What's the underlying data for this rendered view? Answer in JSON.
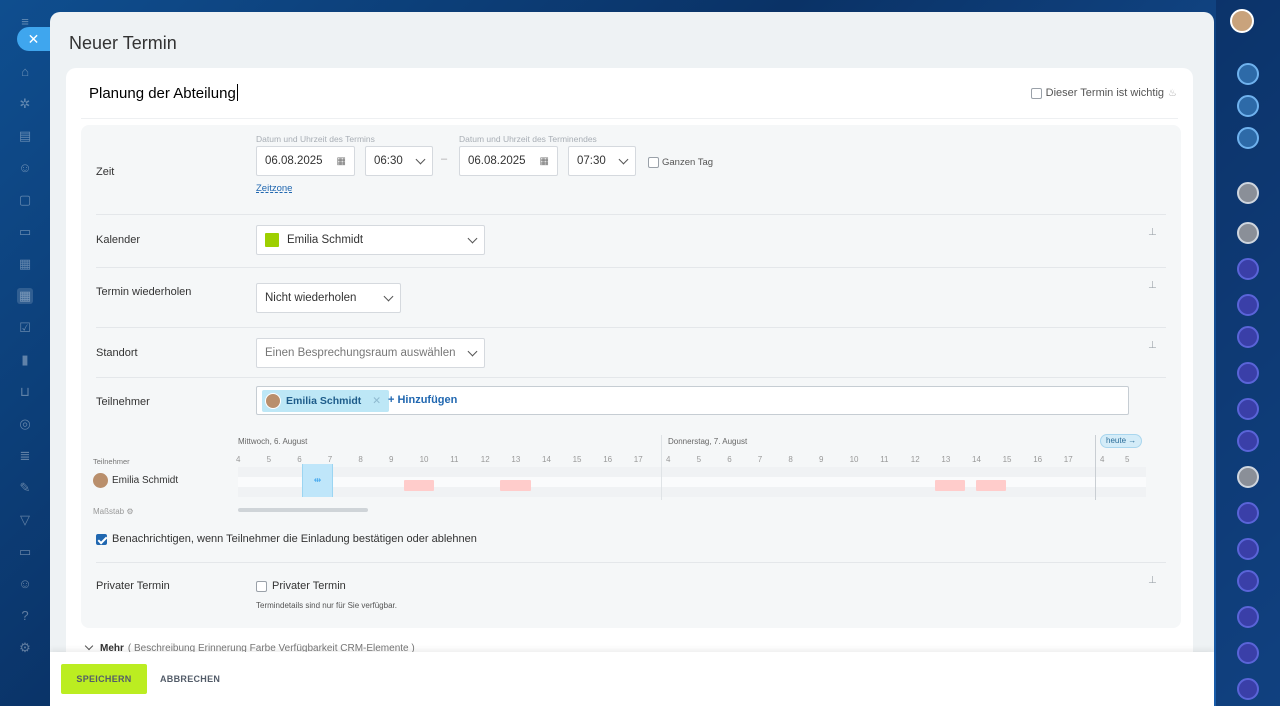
{
  "dialog": {
    "title": "Neuer Termin",
    "event_name": "Planung der Abteilung",
    "important_label": "Dieser Termin ist wichtig"
  },
  "time": {
    "label": "Zeit",
    "start_caption": "Datum und Uhrzeit des Termins",
    "end_caption": "Datum und Uhrzeit des Terminendes",
    "start_date": "06.08.2025",
    "start_time": "06:30",
    "end_date": "06.08.2025",
    "end_time": "07:30",
    "dash": "–",
    "all_day_label": "Ganzen Tag",
    "timezone_link": "Zeitzone"
  },
  "calendar": {
    "label": "Kalender",
    "value": "Emilia Schmidt",
    "color": "#9dcf00"
  },
  "repeat": {
    "label": "Termin wiederholen",
    "value": "Nicht wiederholen"
  },
  "location": {
    "label": "Standort",
    "placeholder": "Einen Besprechungsraum auswählen"
  },
  "attendees": {
    "label": "Teilnehmer",
    "tags": [
      "Emilia Schmidt"
    ],
    "add_label": "+ Hinzufügen"
  },
  "planner": {
    "attendees_title": "Teilnehmer",
    "days": [
      {
        "label": "Mittwoch, 6. August",
        "hours": [
          "4",
          "5",
          "6",
          "7",
          "8",
          "9",
          "10",
          "11",
          "12",
          "13",
          "14",
          "15",
          "16",
          "17"
        ]
      },
      {
        "label": "Donnerstag, 7. August",
        "hours": [
          "4",
          "5",
          "6",
          "7",
          "8",
          "9",
          "10",
          "11",
          "12",
          "13",
          "14",
          "15",
          "16",
          "17"
        ]
      }
    ],
    "next_day_hours": [
      "4",
      "5"
    ],
    "today_label": "heute →",
    "attendee": "Emilia Schmidt",
    "scale_label": "Maßstab"
  },
  "notify": {
    "label": "Benachrichtigen, wenn Teilnehmer die Einladung bestätigen oder ablehnen",
    "checked": true
  },
  "private": {
    "label": "Privater Termin",
    "checkbox_label": "Privater Termin",
    "hint": "Termindetails sind nur für Sie verfügbar."
  },
  "more": {
    "label": "Mehr",
    "items": "( Beschreibung   Erinnerung   Farbe   Verfügbarkeit   CRM-Elemente )"
  },
  "footer": {
    "save_label": "SPEICHERN",
    "cancel_label": "ABBRECHEN"
  },
  "colors": {
    "accent": "#2067b0",
    "save": "#bbed21",
    "busy": "#ffcccb",
    "selection": "#bfe6fa"
  }
}
